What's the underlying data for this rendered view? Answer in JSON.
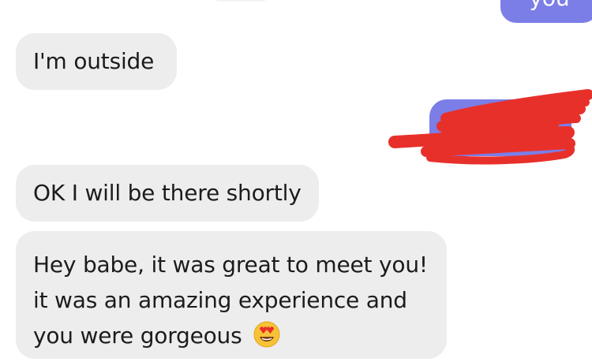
{
  "messages": [
    {
      "direction": "outgoing",
      "text": "you",
      "partially_visible": true
    },
    {
      "direction": "incoming",
      "text": "I'm outside"
    },
    {
      "direction": "outgoing",
      "text": "",
      "redacted": true,
      "redaction_color": "#e8302b"
    },
    {
      "direction": "incoming",
      "text": "OK I will be there shortly"
    },
    {
      "direction": "incoming",
      "lines": [
        "Hey babe, it was great to meet you!",
        "it was an amazing experience and",
        "you were gorgeous"
      ],
      "emoji": "heart-eyes-emoji"
    }
  ],
  "colors": {
    "incoming_bubble": "#ededed",
    "outgoing_bubble": "#7b7ee6",
    "text": "#1c1c1c",
    "redaction": "#e8302b"
  }
}
